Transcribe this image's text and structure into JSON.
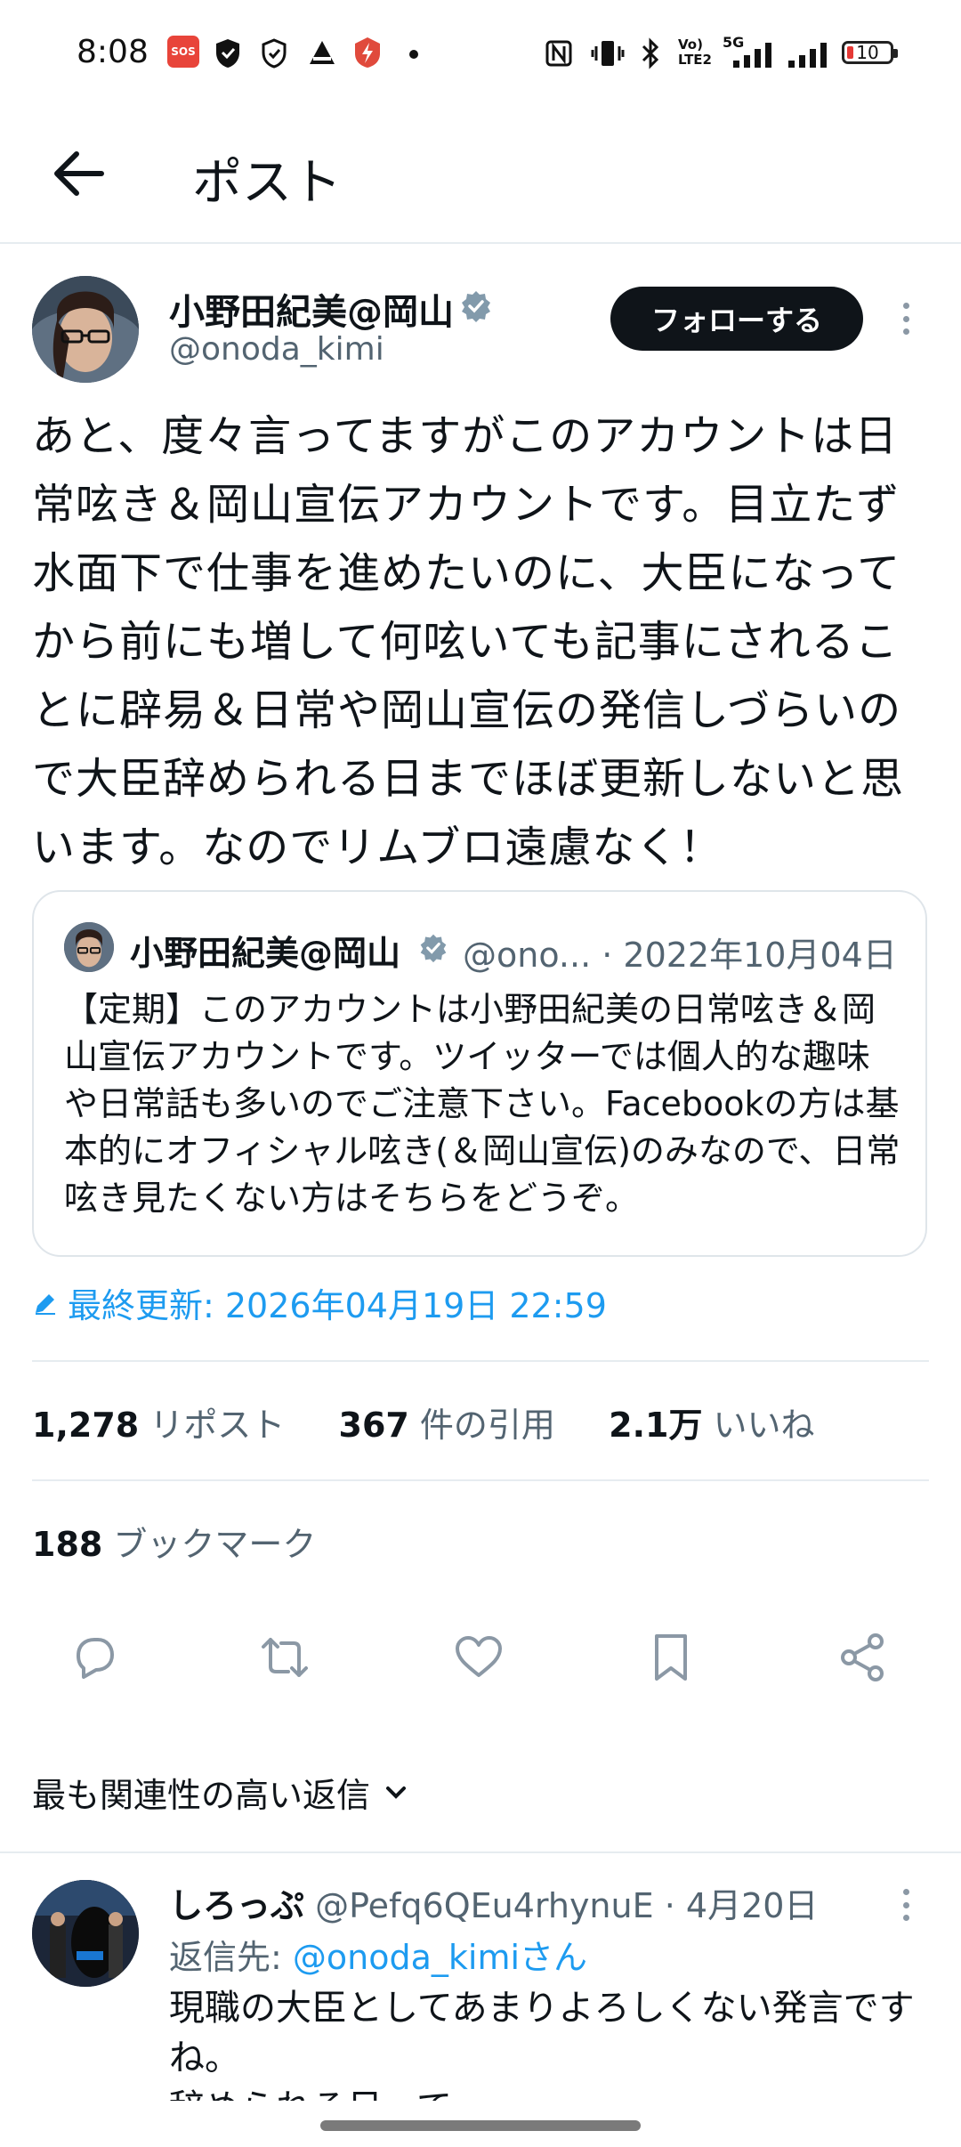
{
  "status_bar": {
    "time": "8:08",
    "sos_label": "SOS",
    "net_label_top": "Vo)",
    "net_label_bottom": "LTE2",
    "net_5g": "5G",
    "battery": "10"
  },
  "header": {
    "title": "ポスト"
  },
  "post": {
    "author_name": "小野田紀美@岡山",
    "author_handle": "@onoda_kimi",
    "follow_label": "フォローする",
    "body": "あと、度々言ってますがこのアカウントは日常呟き＆岡山宣伝アカウントです。目立たず水面下で仕事を進めたいのに、大臣になってから前にも増して何呟いても記事にされることに辟易＆日常や岡山宣伝の発信しづらいので大臣辞められる日までほぼ更新しないと思います。なのでリムブロ遠慮なく！",
    "quote": {
      "name": "小野田紀美@岡山",
      "handle": "@ono...",
      "date": "2022年10月04日",
      "body": "【定期】このアカウントは小野田紀美の日常呟き＆岡山宣伝アカウントです。ツイッターでは個人的な趣味や日常話も多いのでご注意下さい。Facebookの方は基本的にオフィシャル呟き(＆岡山宣伝)のみなので、日常呟き見たくない方はそちらをどうぞ。"
    },
    "last_edited": "最終更新: 2026年04月19日 22:59",
    "reposts_count": "1,278",
    "reposts_label": "リポスト",
    "quotes_count": "367",
    "quotes_label": "件の引用",
    "likes_count": "2.1万",
    "likes_label": "いいね",
    "bookmarks_count": "188",
    "bookmarks_label": "ブックマーク"
  },
  "replies_sort_label": "最も関連性の高い返信",
  "reply": {
    "name": "しろっぷ",
    "handle": "@Pefq6QEu4rhynuE",
    "date": "4月20日",
    "to_prefix": "返信先: ",
    "to_handle": "@onoda_kimiさん",
    "body": "現職の大臣としてあまりよろしくない発言ですね。\n辞められる日って"
  },
  "colors": {
    "accent": "#1d9bf0",
    "text": "#0f1419",
    "muted": "#536471",
    "follow_bg": "#0f1419"
  }
}
